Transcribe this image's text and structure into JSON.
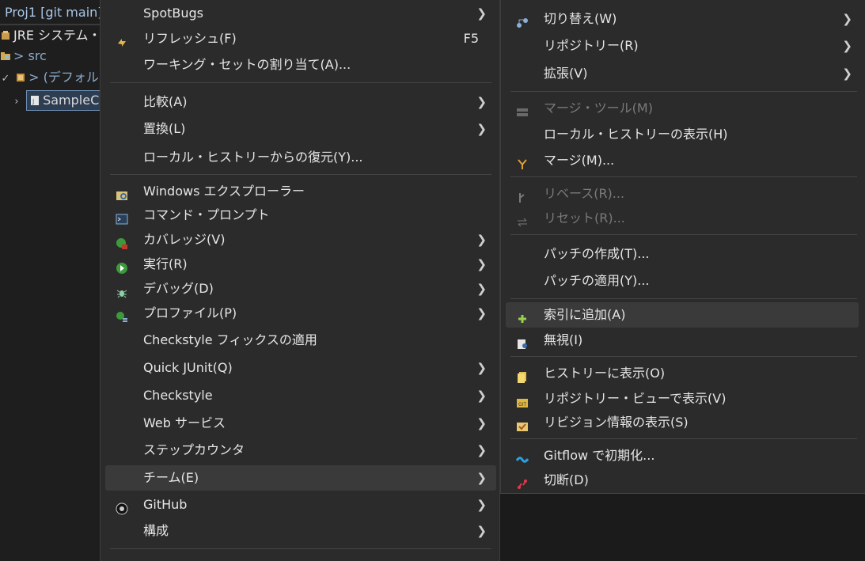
{
  "explorer": {
    "title": "Proj1 [git main]",
    "items": [
      {
        "label": "JRE システム・ライ"
      },
      {
        "label": "> src"
      },
      {
        "label": "> (デフォルト"
      },
      {
        "label": "SampleC"
      }
    ]
  },
  "menu": {
    "items": [
      {
        "label": "SpotBugs"
      },
      {
        "label": "リフレッシュ(F)",
        "accel": "F5"
      },
      {
        "label": "ワーキング・セットの割り当て(A)..."
      },
      {
        "label": "比較(A)"
      },
      {
        "label": "置換(L)"
      },
      {
        "label": "ローカル・ヒストリーからの復元(Y)..."
      },
      {
        "label": "Windows エクスプローラー"
      },
      {
        "label": "コマンド・プロンプト"
      },
      {
        "label": "カバレッジ(V)"
      },
      {
        "label": "実行(R)"
      },
      {
        "label": "デバッグ(D)"
      },
      {
        "label": "プロファイル(P)"
      },
      {
        "label": "Checkstyle フィックスの適用"
      },
      {
        "label": "Quick JUnit(Q)"
      },
      {
        "label": "Checkstyle"
      },
      {
        "label": "Web サービス"
      },
      {
        "label": "ステップカウンタ"
      },
      {
        "label": "チーム(E)"
      },
      {
        "label": "GitHub"
      },
      {
        "label": "構成"
      }
    ]
  },
  "submenu": {
    "items": [
      {
        "label": "切り替え(W)"
      },
      {
        "label": "リポジトリー(R)"
      },
      {
        "label": "拡張(V)"
      },
      {
        "label": "マージ・ツール(M)"
      },
      {
        "label": "ローカル・ヒストリーの表示(H)"
      },
      {
        "label": "マージ(M)..."
      },
      {
        "label": "リベース(R)..."
      },
      {
        "label": "リセット(R)..."
      },
      {
        "label": "パッチの作成(T)..."
      },
      {
        "label": "パッチの適用(Y)..."
      },
      {
        "label": "索引に追加(A)"
      },
      {
        "label": "無視(I)"
      },
      {
        "label": "ヒストリーに表示(O)"
      },
      {
        "label": "リポジトリー・ビューで表示(V)"
      },
      {
        "label": "リビジョン情報の表示(S)"
      },
      {
        "label": "Gitflow で初期化..."
      },
      {
        "label": "切断(D)"
      }
    ]
  },
  "colors": {
    "menu_bg": "#2b2b2b",
    "hover_bg": "#3a3a3a",
    "disabled_text": "#7a7a7a",
    "explorer_title": "#a9c6e8"
  }
}
